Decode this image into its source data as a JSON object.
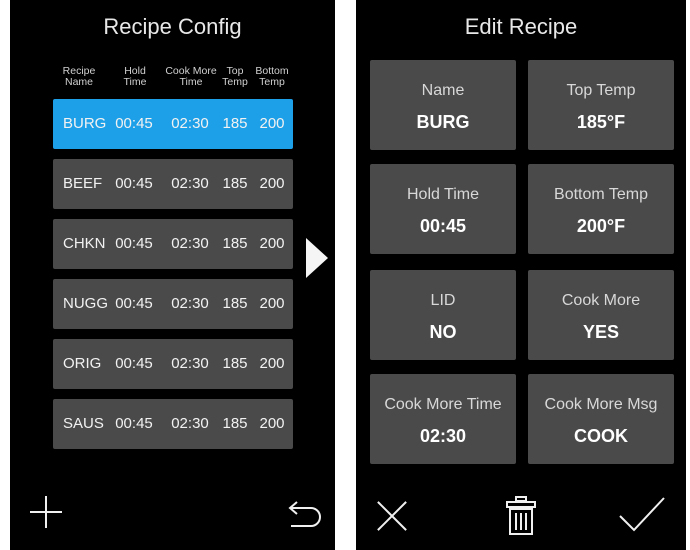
{
  "left": {
    "title": "Recipe Config",
    "headers": [
      [
        "Recipe",
        "Name"
      ],
      [
        "Hold",
        "Time"
      ],
      [
        "Cook More",
        "Time"
      ],
      [
        "Top",
        "Temp"
      ],
      [
        "Bottom",
        "Temp"
      ]
    ],
    "rows": [
      [
        "BURG",
        "00:45",
        "02:30",
        "185",
        "200"
      ],
      [
        "BEEF",
        "00:45",
        "02:30",
        "185",
        "200"
      ],
      [
        "CHKN",
        "00:45",
        "02:30",
        "185",
        "200"
      ],
      [
        "NUGG",
        "00:45",
        "02:30",
        "185",
        "200"
      ],
      [
        "ORIG",
        "00:45",
        "02:30",
        "185",
        "200"
      ],
      [
        "SAUS",
        "00:45",
        "02:30",
        "185",
        "200"
      ]
    ],
    "selected_row": 0,
    "accent": "#1ea0e8"
  },
  "right": {
    "title": "Edit Recipe",
    "tiles": [
      {
        "label": "Name",
        "value": "BURG"
      },
      {
        "label": "Top Temp",
        "value": "185°F"
      },
      {
        "label": "Hold Time",
        "value": "00:45"
      },
      {
        "label": "Bottom Temp",
        "value": "200°F"
      },
      {
        "label": "LID",
        "value": "NO"
      },
      {
        "label": "Cook More",
        "value": "YES"
      },
      {
        "label": "Cook More Time",
        "value": "02:30"
      },
      {
        "label": "Cook More Msg",
        "value": "COOK"
      }
    ]
  },
  "icons": {
    "add": "plus-icon",
    "back": "return-arrow-icon",
    "next": "right-arrow-icon",
    "cancel": "close-icon",
    "delete": "trash-icon",
    "confirm": "checkmark-icon"
  }
}
